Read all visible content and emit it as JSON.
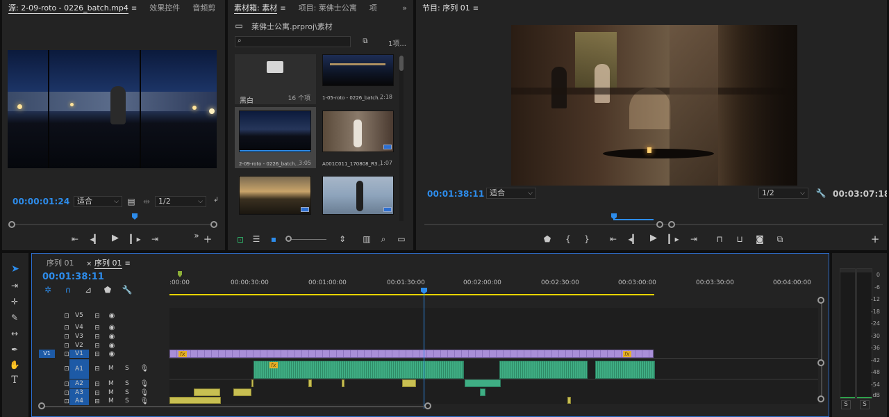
{
  "source_panel": {
    "tabs": [
      "源: 2-09-roto - 0226_batch.mp4",
      "效果控件",
      "音频剪"
    ],
    "timecode": "00:00:01:24",
    "fit_label": "适合",
    "resolution_label": "1/2"
  },
  "bin_panel": {
    "tabs": [
      "素材箱: 素材",
      "项目: 莱佛士公寓",
      "项"
    ],
    "path": "莱佛士公寓.prproj\\素材",
    "item_count": "1项...",
    "items": [
      {
        "name": "黑白",
        "meta": "16 个项",
        "kind": "folder"
      },
      {
        "name": "1-05-roto - 0226_batch...",
        "meta": "2:18",
        "kind": "video"
      },
      {
        "name": "2-09-roto - 0226_batch...",
        "meta": "3:05",
        "kind": "video"
      },
      {
        "name": "A001C011_170808_R3...",
        "meta": "1:07",
        "kind": "video"
      },
      {
        "name": "",
        "meta": "",
        "kind": "video"
      },
      {
        "name": "",
        "meta": "",
        "kind": "video"
      }
    ]
  },
  "program_panel": {
    "tab": "节目: 序列 01",
    "timecode": "00:01:38:11",
    "fit_label": "适合",
    "resolution_label": "1/2",
    "duration": "00:03:07:18"
  },
  "timeline": {
    "tabs": [
      "序列 01",
      "序列 01"
    ],
    "timecode": "00:01:38:11",
    "ruler": [
      ":00:00",
      "00:00:30:00",
      "00:01:00:00",
      "00:01:30:00",
      "00:02:00:00",
      "00:02:30:00",
      "00:03:00:00",
      "00:03:30:00",
      "00:04:00:00"
    ],
    "video_tracks": [
      "V5",
      "V4",
      "V3",
      "V2",
      "V1"
    ],
    "audio_tracks": [
      "A1",
      "A2",
      "A3",
      "A4"
    ],
    "source_patch_v": "V1",
    "track_buttons": {
      "mute": "M",
      "solo": "S"
    }
  },
  "audio_meter": {
    "scale": [
      "0",
      "-6",
      "-12",
      "-18",
      "-24",
      "-30",
      "-36",
      "-42",
      "-48",
      "-54",
      "dB"
    ],
    "solo_labels": [
      "S",
      "S"
    ]
  },
  "colors": {
    "accent": "#2d8ceb",
    "video_clip": "#a98fd8",
    "audio_clip": "#3fae84",
    "playhead": "#2d8ceb",
    "work_area": "#e8d400"
  }
}
